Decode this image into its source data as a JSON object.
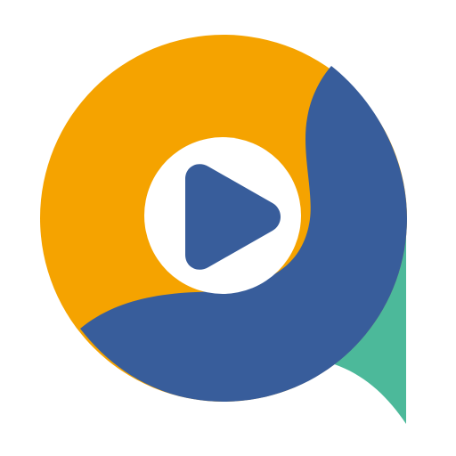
{
  "app_icon": {
    "icon_name": "video-chat-bubble-play-icon",
    "colors": {
      "background": "#ffffff",
      "orange": "#f5a300",
      "blue": "#385d9b",
      "green": "#4cb99a",
      "play_circle": "#ffffff",
      "play_triangle": "#385d9b"
    }
  }
}
